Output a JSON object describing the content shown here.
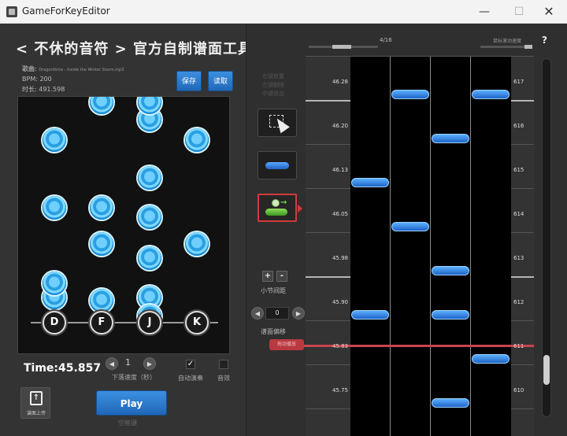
{
  "window": {
    "title": "GameForKeyEditor",
    "min_label": "—",
    "max_label": "☐",
    "close_label": "✕"
  },
  "header": {
    "title": "< 不休的音符 > 官方自制谱面工具"
  },
  "song_info": {
    "song_label": "歌曲:",
    "song_file": "Dragonforce - Inside the Winter Storm.mp3",
    "bpm": "BPM: 200",
    "duration": "时长: 491.598"
  },
  "buttons": {
    "save": "保存",
    "load": "读取",
    "play": "Play",
    "play_sub": "空格键",
    "upload": "谱面上传"
  },
  "preview": {
    "keys": [
      "D",
      "F",
      "J",
      "K"
    ],
    "notes": [
      {
        "lane": 1,
        "row": 0
      },
      {
        "lane": 2,
        "row": 0
      },
      {
        "lane": 2,
        "row": 1
      },
      {
        "lane": 0,
        "row": 2
      },
      {
        "lane": 3,
        "row": 2
      },
      {
        "lane": 2,
        "row": 3
      },
      {
        "lane": 0,
        "row": 4
      },
      {
        "lane": 1,
        "row": 4
      },
      {
        "lane": 2,
        "row": 5
      },
      {
        "lane": 1,
        "row": 6
      },
      {
        "lane": 3,
        "row": 6
      },
      {
        "lane": 2,
        "row": 7
      },
      {
        "lane": 0,
        "row": 8
      },
      {
        "lane": 1,
        "row": 9
      },
      {
        "lane": 2,
        "row": 10
      },
      {
        "lane": 0,
        "row": 11
      },
      {
        "lane": 2,
        "row": 11
      }
    ]
  },
  "status": {
    "time": "Time:45.857",
    "speed_value": "1",
    "speed_label": "下落速度（秒）",
    "auto_play_label": "自动演奏",
    "auto_play_checked": true,
    "sfx_label": "音效",
    "sfx_checked": false
  },
  "tools": {
    "hint": "右键放置\n左键删除\n中键退出",
    "section_label": "小节间距",
    "offset_label": "谱面偏移",
    "offset_value": "0",
    "left_arrow": "◀",
    "right_arrow": "▶",
    "plus": "+",
    "minus": "-"
  },
  "editor": {
    "page": "4/16",
    "scroll_speed_label": "鼠标滚动速度",
    "help": "?",
    "playhead_label": "拖动播放",
    "rows": [
      {
        "time": "46.28",
        "measure": "617"
      },
      {
        "time": "46.20",
        "measure": "616"
      },
      {
        "time": "46.13",
        "measure": "615"
      },
      {
        "time": "46.05",
        "measure": "614"
      },
      {
        "time": "45.98",
        "measure": "613"
      },
      {
        "time": "45.90",
        "measure": "612"
      },
      {
        "time": "45.83",
        "measure": "611"
      },
      {
        "time": "45.75",
        "measure": "610"
      }
    ],
    "notes": [
      {
        "lane": 1,
        "row": 0
      },
      {
        "lane": 3,
        "row": 0
      },
      {
        "lane": 2,
        "row": 1
      },
      {
        "lane": 0,
        "row": 2
      },
      {
        "lane": 1,
        "row": 3
      },
      {
        "lane": 2,
        "row": 4
      },
      {
        "lane": 0,
        "row": 5
      },
      {
        "lane": 2,
        "row": 5
      },
      {
        "lane": 3,
        "row": 6
      },
      {
        "lane": 2,
        "row": 7
      }
    ]
  }
}
